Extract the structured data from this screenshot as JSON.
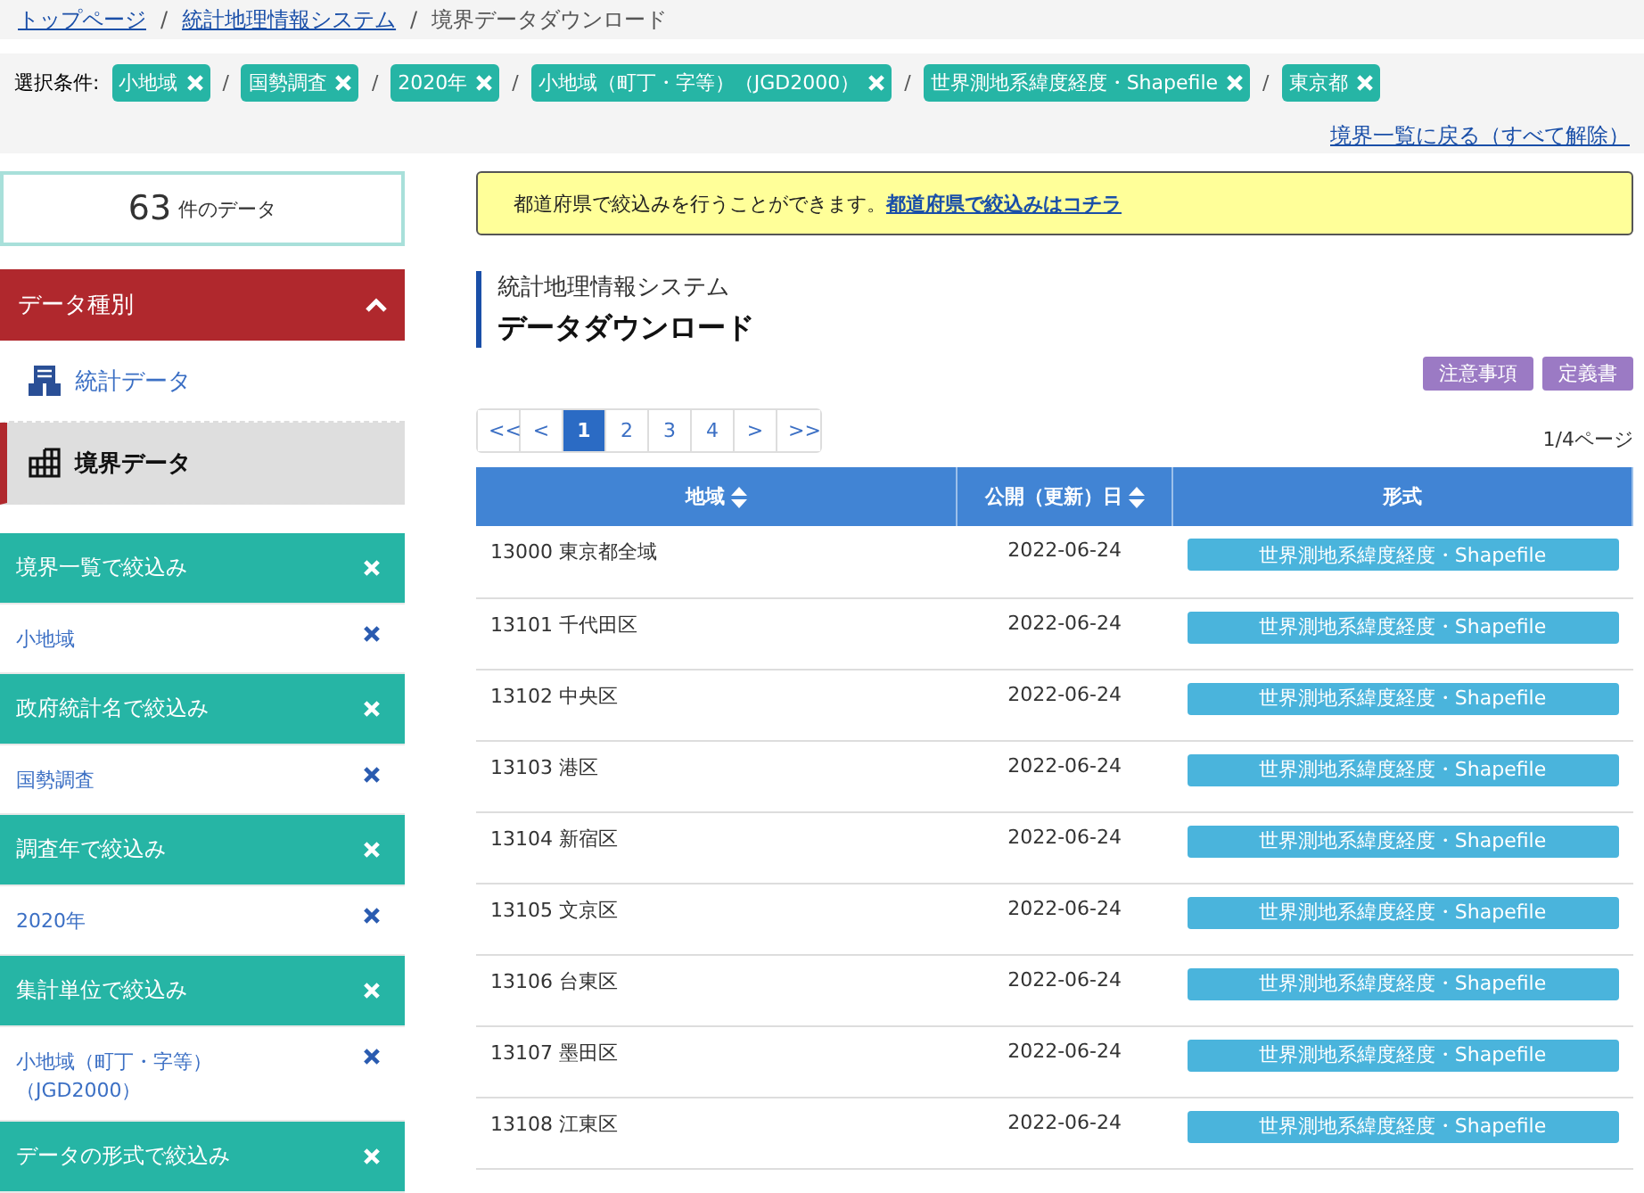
{
  "separator": "/",
  "breadcrumb": [
    {
      "label": "トップページ",
      "link": true
    },
    {
      "label": "統計地理情報システム",
      "link": true
    },
    {
      "label": "境界データダウンロード",
      "link": false
    }
  ],
  "conditions": {
    "label": "選択条件:",
    "tags": [
      "小地域",
      "国勢調査",
      "2020年",
      "小地域（町丁・字等）（JGD2000）",
      "世界測地系緯度経度・Shapefile",
      "東京都"
    ],
    "reset_link": "境界一覧に戻る（すべて解除）"
  },
  "count": {
    "number": "63",
    "unit": "件のデータ"
  },
  "data_type": {
    "title": "データ種別",
    "expanded": true,
    "items": [
      {
        "label": "統計データ",
        "kind": "stats",
        "selected": false
      },
      {
        "label": "境界データ",
        "kind": "boundary",
        "selected": true
      }
    ]
  },
  "filters": [
    {
      "title": "境界一覧で絞込み",
      "value": "小地域"
    },
    {
      "title": "政府統計名で絞込み",
      "value": "国勢調査"
    },
    {
      "title": "調査年で絞込み",
      "value": "2020年"
    },
    {
      "title": "集計単位で絞込み",
      "value": "小地域（町丁・字等）（JGD2000）"
    },
    {
      "title": "データの形式で絞込み"
    }
  ],
  "notice": {
    "text": "都道府県で絞込みを行うことができます。",
    "link": "都道府県で絞込みはコチラ"
  },
  "heading": {
    "subtitle": "統計地理情報システム",
    "title": "データダウンロード"
  },
  "doc_buttons": [
    "注意事項",
    "定義書"
  ],
  "pagination": {
    "pages": [
      {
        "label": "<<",
        "selected": false
      },
      {
        "label": "<",
        "selected": false
      },
      {
        "label": "1",
        "selected": true
      },
      {
        "label": "2",
        "selected": false
      },
      {
        "label": "3",
        "selected": false
      },
      {
        "label": "4",
        "selected": false
      },
      {
        "label": ">",
        "selected": false
      },
      {
        "label": ">>",
        "selected": false
      }
    ],
    "info": "1/4ページ"
  },
  "table": {
    "columns": [
      {
        "label": "地域",
        "sortable": true
      },
      {
        "label": "公開（更新）日",
        "sortable": true
      },
      {
        "label": "形式",
        "sortable": false
      }
    ],
    "rows": [
      [
        "13000 東京都全域",
        "2022-06-24",
        "世界測地系緯度経度・Shapefile"
      ],
      [
        "13101 千代田区",
        "2022-06-24",
        "世界測地系緯度経度・Shapefile"
      ],
      [
        "13102 中央区",
        "2022-06-24",
        "世界測地系緯度経度・Shapefile"
      ],
      [
        "13103 港区",
        "2022-06-24",
        "世界測地系緯度経度・Shapefile"
      ],
      [
        "13104 新宿区",
        "2022-06-24",
        "世界測地系緯度経度・Shapefile"
      ],
      [
        "13105 文京区",
        "2022-06-24",
        "世界測地系緯度経度・Shapefile"
      ],
      [
        "13106 台東区",
        "2022-06-24",
        "世界測地系緯度経度・Shapefile"
      ],
      [
        "13107 墨田区",
        "2022-06-24",
        "世界測地系緯度経度・Shapefile"
      ],
      [
        "13108 江東区",
        "2022-06-24",
        "世界測地系緯度経度・Shapefile"
      ]
    ]
  }
}
